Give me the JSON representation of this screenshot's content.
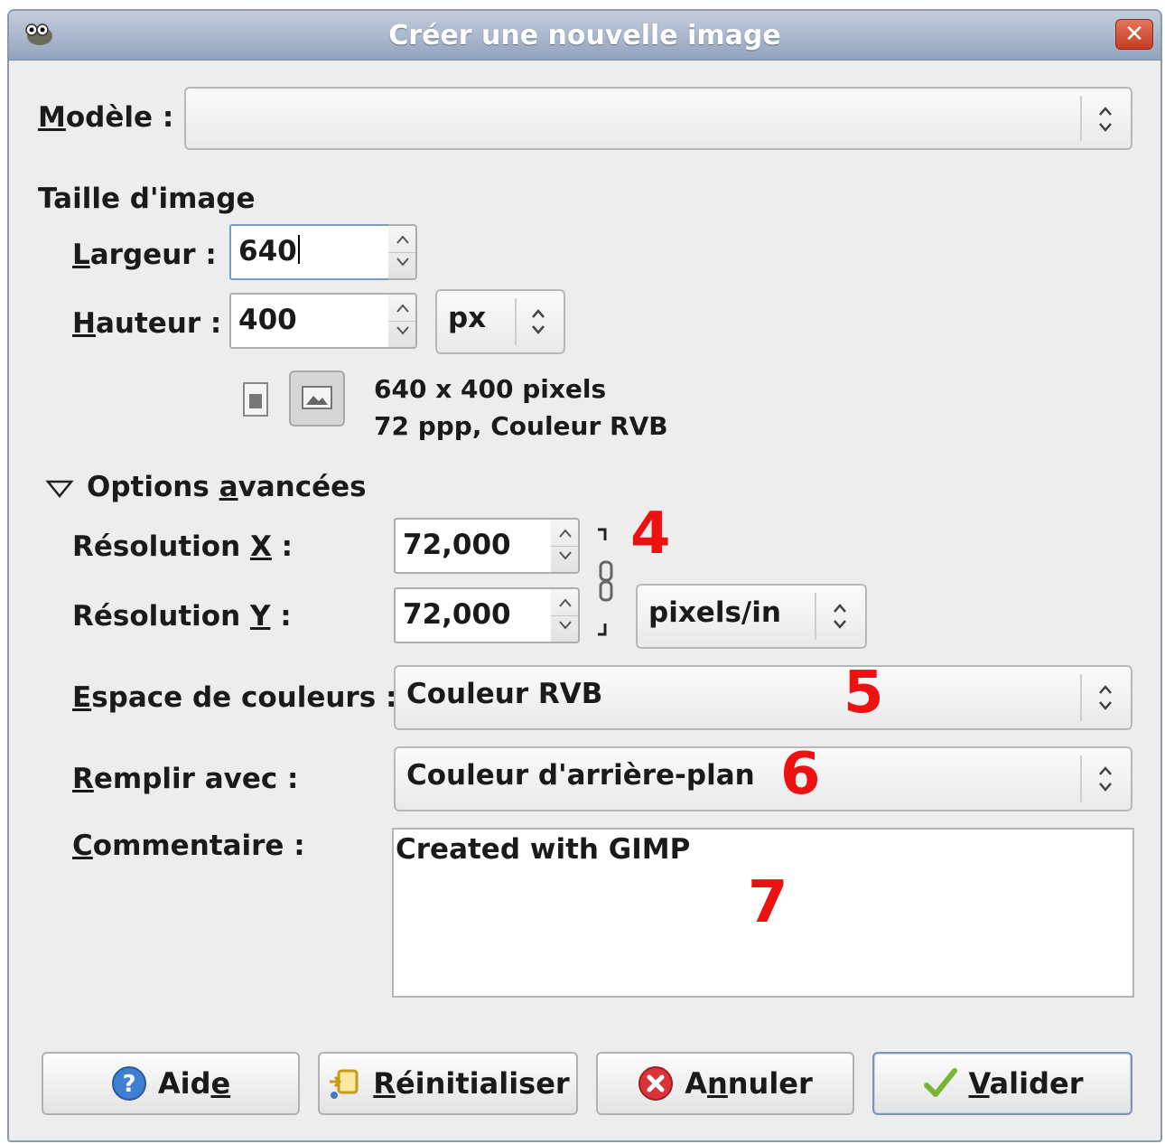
{
  "window": {
    "title": "Créer une nouvelle image",
    "close_label": "✕"
  },
  "template": {
    "label_pre": "",
    "label_u": "M",
    "label_post": "odèle :",
    "value": ""
  },
  "image_size": {
    "heading": "Taille d'image",
    "width": {
      "label_u": "L",
      "label_post": "argeur :",
      "value": "640"
    },
    "height": {
      "label_u": "H",
      "label_post": "auteur :",
      "value": "400"
    },
    "unit": "px",
    "info_line1": "640 x 400 pixels",
    "info_line2": "72 ppp, Couleur RVB"
  },
  "advanced": {
    "heading_pre": "Options ",
    "heading_u": "a",
    "heading_post": "vancées",
    "res_x": {
      "label_pre": "Résolution ",
      "label_u": "X",
      "label_post": " :",
      "value": "72,000"
    },
    "res_y": {
      "label_pre": "Résolution ",
      "label_u": "Y",
      "label_post": " :",
      "value": "72,000"
    },
    "res_unit": "pixels/in",
    "colorspace": {
      "label_u": "E",
      "label_post": "space de couleurs :",
      "value": "Couleur RVB"
    },
    "fill": {
      "label_u": "R",
      "label_post": "emplir avec :",
      "value": "Couleur d'arrière-plan"
    },
    "comment": {
      "label_u": "C",
      "label_post": "ommentaire :",
      "value": "Created with GIMP"
    }
  },
  "annotations": {
    "n4": "4",
    "n5": "5",
    "n6": "6",
    "n7": "7"
  },
  "buttons": {
    "help": {
      "pre": "Aid",
      "u": "e",
      "post": ""
    },
    "reset": {
      "pre": "",
      "u": "R",
      "post": "éinitialiser"
    },
    "cancel": {
      "pre": "A",
      "u": "n",
      "post": "nuler"
    },
    "ok": {
      "pre": "",
      "u": "V",
      "post": "alider"
    }
  },
  "colors": {
    "accent_red": "#ee1111",
    "title_bar": "#a6b4cb"
  },
  "icons": [
    "gimp-wilber-icon",
    "close-icon",
    "portrait-icon",
    "landscape-icon",
    "chain-link-icon",
    "help-icon",
    "reset-icon",
    "cancel-icon",
    "checkmark-icon"
  ]
}
